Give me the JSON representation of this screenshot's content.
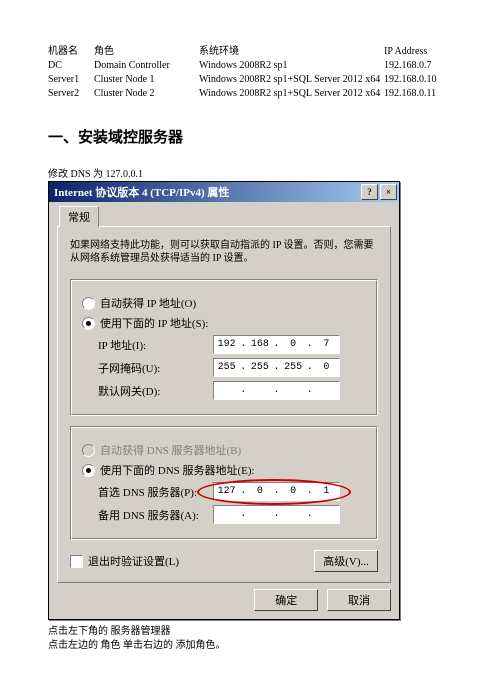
{
  "table": {
    "headers": [
      "机器名",
      "角色",
      "系统环境",
      "IP Address"
    ],
    "rows": [
      [
        "DC",
        "Domain Controller",
        "Windows 2008R2 sp1",
        "192.168.0.7"
      ],
      [
        "Server1",
        "Cluster Node 1",
        "Windows 2008R2 sp1+SQL Server 2012 x64",
        "192.168.0.10"
      ],
      [
        "Server2",
        "Cluster Node 2",
        "Windows 2008R2 sp1+SQL Server 2012 x64",
        "192.168.0.11"
      ]
    ]
  },
  "heading": "一、安装域控服务器",
  "dns_note": "修改 DNS 为 127.0.0.1",
  "dialog": {
    "title": "Internet 协议版本 4 (TCP/IPv4) 属性",
    "tab": "常规",
    "instruction": "如果网络支持此功能，则可以获取自动指派的 IP 设置。否则，您需要从网络系统管理员处获得适当的 IP 设置。",
    "ip": {
      "auto_label": "自动获得 IP 地址(O)",
      "manual_label": "使用下面的 IP 地址(S):",
      "addr_label": "IP 地址(I):",
      "addr": [
        "192",
        "168",
        "0",
        "7"
      ],
      "mask_label": "子网掩码(U):",
      "mask": [
        "255",
        "255",
        "255",
        "0"
      ],
      "gw_label": "默认网关(D):",
      "gw": [
        "",
        "",
        "",
        ""
      ]
    },
    "dns": {
      "auto_label": "自动获得 DNS 服务器地址(B)",
      "manual_label": "使用下面的 DNS 服务器地址(E):",
      "pref_label": "首选 DNS 服务器(P):",
      "pref": [
        "127",
        "0",
        "0",
        "1"
      ],
      "alt_label": "备用 DNS 服务器(A):",
      "alt": [
        "",
        "",
        "",
        ""
      ]
    },
    "validate": "退出时验证设置(L)",
    "advanced": "高级(V)...",
    "ok": "确定",
    "cancel": "取消"
  },
  "footer1": "点击左下角的 服务器管理器",
  "footer2": "点击左边的 角色 单击右边的 添加角色。"
}
